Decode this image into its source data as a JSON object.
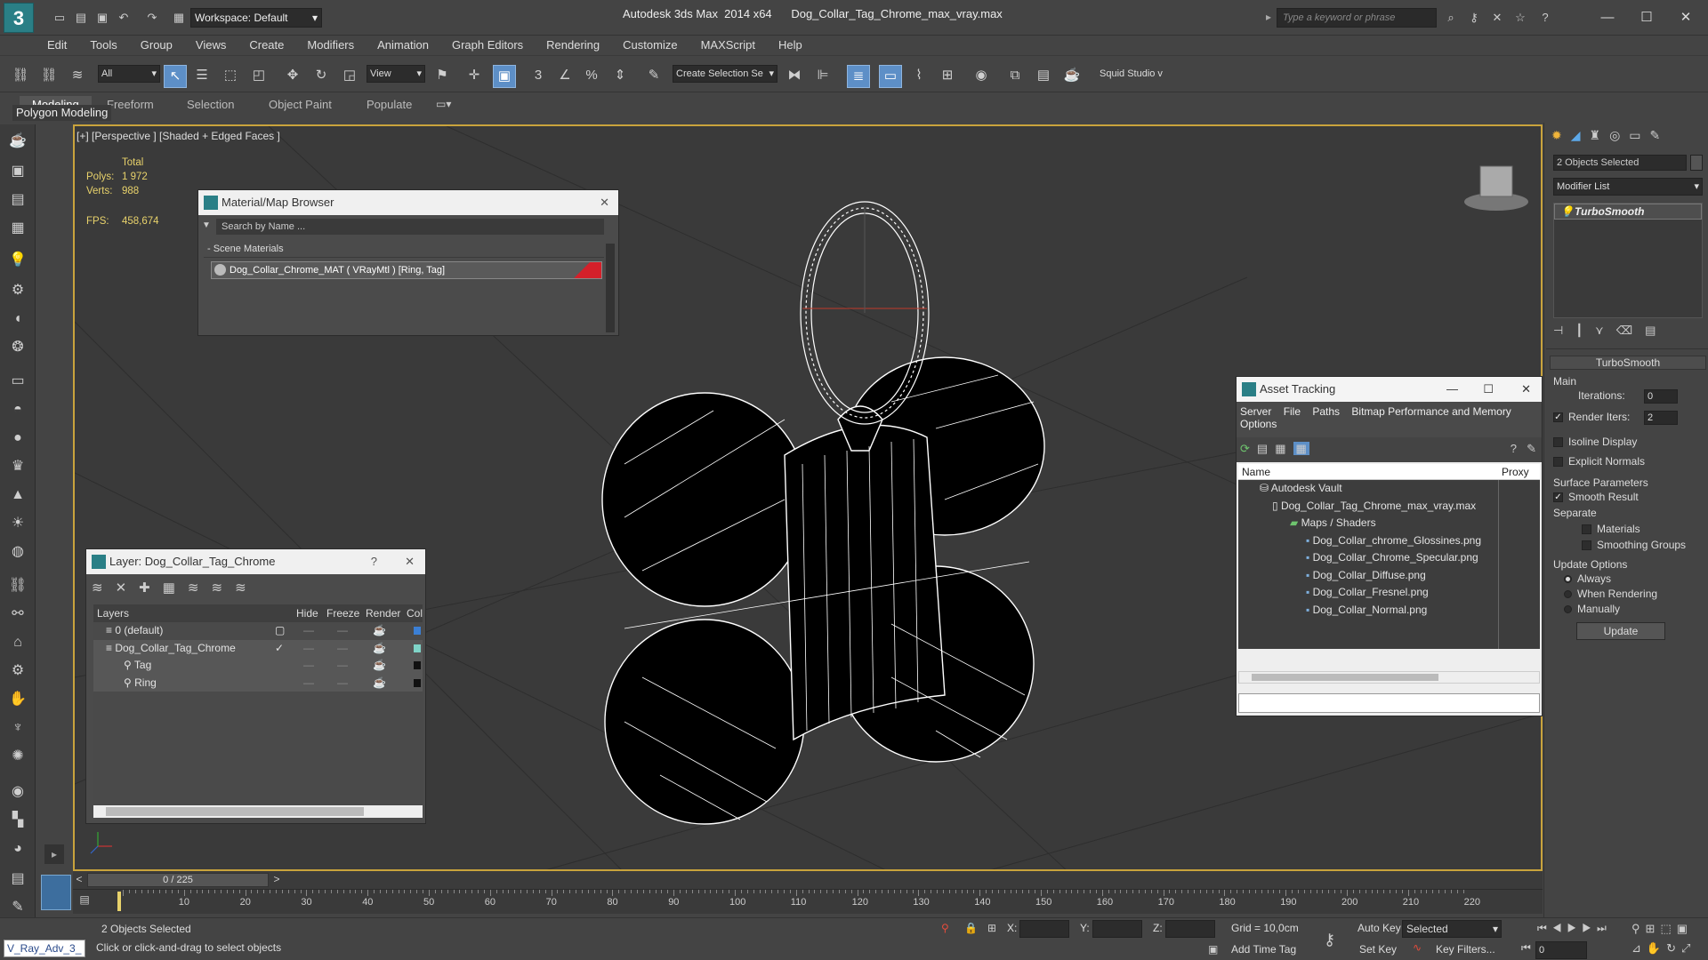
{
  "app": {
    "title": "Autodesk 3ds Max  2014 x64      Dog_Collar_Tag_Chrome_max_vray.max",
    "logo": "3",
    "workspace": "Workspace: Default",
    "search_placeholder": "Type a keyword or phrase"
  },
  "menu": [
    "Edit",
    "Tools",
    "Group",
    "Views",
    "Create",
    "Modifiers",
    "Animation",
    "Graph Editors",
    "Rendering",
    "Customize",
    "MAXScript",
    "Help"
  ],
  "toolbar": {
    "selection_filter": "All",
    "ref_coord": "View",
    "selection_set": "Create Selection Se",
    "snap_3": "3",
    "squid": "Squid Studio v"
  },
  "ribbon": {
    "tabs": [
      "Modeling",
      "Freeform",
      "Selection",
      "Object Paint",
      "Populate"
    ],
    "active_tab": "Modeling",
    "panel": "Polygon Modeling"
  },
  "viewport": {
    "label": "[+] [Perspective ] [Shaded + Edged Faces ]",
    "stats": {
      "total": "Total",
      "polys_label": "Polys:",
      "polys": "1 972",
      "verts_label": "Verts:",
      "verts": "988",
      "fps_label": "FPS:",
      "fps": "458,674"
    }
  },
  "material_browser": {
    "title": "Material/Map Browser",
    "search": "Search by Name ...",
    "group": "- Scene Materials",
    "item": "Dog_Collar_Chrome_MAT ( VRayMtl ) [Ring, Tag]",
    "accent": "#d4202a"
  },
  "layer_window": {
    "title": "Layer: Dog_Collar_Tag_Chrome",
    "help": "?",
    "columns": [
      "Layers",
      "Hide",
      "Freeze",
      "Render",
      "Col"
    ],
    "rows": [
      {
        "name": "0 (default)",
        "indent": 0,
        "color": "#3b7fd4"
      },
      {
        "name": "Dog_Collar_Tag_Chrome",
        "indent": 0,
        "color": "#7fd4c8"
      },
      {
        "name": "Tag",
        "indent": 1,
        "color": "#111111"
      },
      {
        "name": "Ring",
        "indent": 1,
        "color": "#111111"
      }
    ]
  },
  "asset_tracking": {
    "title": "Asset Tracking",
    "menu": [
      "Server",
      "File",
      "Paths",
      "Bitmap Performance and Memory",
      "Options"
    ],
    "columns": [
      "Name",
      "Proxy"
    ],
    "rows": [
      {
        "name": "Autodesk Vault",
        "level": 0
      },
      {
        "name": "Dog_Collar_Tag_Chrome_max_vray.max",
        "level": 1
      },
      {
        "name": "Maps / Shaders",
        "level": 2
      },
      {
        "name": "Dog_Collar_chrome_Glossines.png",
        "level": 3
      },
      {
        "name": "Dog_Collar_Chrome_Specular.png",
        "level": 3
      },
      {
        "name": "Dog_Collar_Diffuse.png",
        "level": 3
      },
      {
        "name": "Dog_Collar_Fresnel.png",
        "level": 3
      },
      {
        "name": "Dog_Collar_Normal.png",
        "level": 3
      }
    ]
  },
  "command_panel": {
    "selected": "2 Objects Selected",
    "modifier_list": "Modifier List",
    "stack_item": "TurboSmooth",
    "rollout": "TurboSmooth",
    "main": "Main",
    "iterations_label": "Iterations:",
    "iterations": "0",
    "render_iters_label": "Render Iters:",
    "render_iters": "2",
    "isoline": "Isoline Display",
    "explicit": "Explicit Normals",
    "surface": "Surface Parameters",
    "smooth_result": "Smooth Result",
    "separate": "Separate",
    "materials": "Materials",
    "smoothing_groups": "Smoothing Groups",
    "update_options": "Update Options",
    "always": "Always",
    "when_rendering": "When Rendering",
    "manually": "Manually",
    "update_btn": "Update"
  },
  "timeline": {
    "frame": "0 / 225",
    "ticks": [
      "10",
      "20",
      "30",
      "40",
      "50",
      "60",
      "70",
      "80",
      "90",
      "100",
      "110",
      "120",
      "130",
      "140",
      "150",
      "160",
      "170",
      "180",
      "190",
      "200",
      "210",
      "220"
    ]
  },
  "status": {
    "script": "V_Ray_Adv_3_",
    "selected": "2 Objects Selected",
    "prompt": "Click or click-and-drag to select objects",
    "x": "X:",
    "y": "Y:",
    "z": "Z:",
    "grid": "Grid = 10,0cm",
    "add_time_tag": "Add Time Tag",
    "auto_key": "Auto Key",
    "set_key": "Set Key",
    "key_mode": "Selected",
    "key_filters": "Key Filters...",
    "frame_field": "0"
  }
}
